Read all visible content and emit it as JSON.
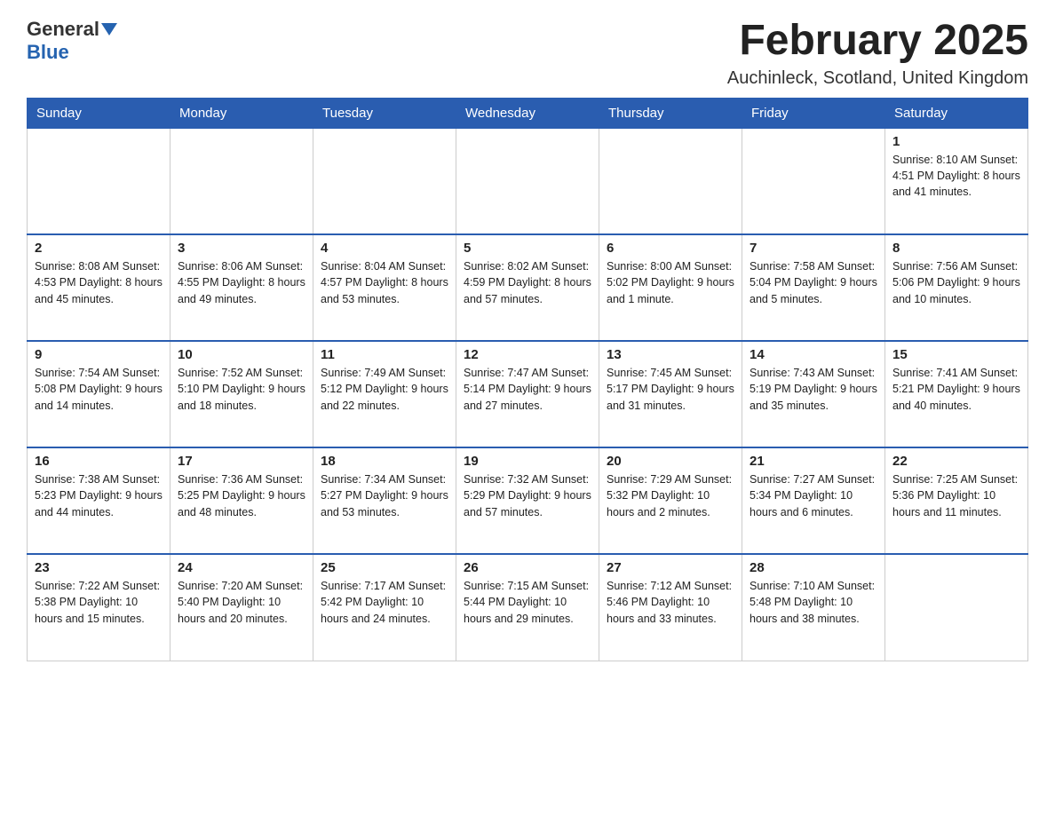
{
  "header": {
    "logo_general": "General",
    "logo_blue": "Blue",
    "month_title": "February 2025",
    "location": "Auchinleck, Scotland, United Kingdom"
  },
  "days_of_week": [
    "Sunday",
    "Monday",
    "Tuesday",
    "Wednesday",
    "Thursday",
    "Friday",
    "Saturday"
  ],
  "weeks": [
    [
      {
        "day": "",
        "info": ""
      },
      {
        "day": "",
        "info": ""
      },
      {
        "day": "",
        "info": ""
      },
      {
        "day": "",
        "info": ""
      },
      {
        "day": "",
        "info": ""
      },
      {
        "day": "",
        "info": ""
      },
      {
        "day": "1",
        "info": "Sunrise: 8:10 AM\nSunset: 4:51 PM\nDaylight: 8 hours\nand 41 minutes."
      }
    ],
    [
      {
        "day": "2",
        "info": "Sunrise: 8:08 AM\nSunset: 4:53 PM\nDaylight: 8 hours\nand 45 minutes."
      },
      {
        "day": "3",
        "info": "Sunrise: 8:06 AM\nSunset: 4:55 PM\nDaylight: 8 hours\nand 49 minutes."
      },
      {
        "day": "4",
        "info": "Sunrise: 8:04 AM\nSunset: 4:57 PM\nDaylight: 8 hours\nand 53 minutes."
      },
      {
        "day": "5",
        "info": "Sunrise: 8:02 AM\nSunset: 4:59 PM\nDaylight: 8 hours\nand 57 minutes."
      },
      {
        "day": "6",
        "info": "Sunrise: 8:00 AM\nSunset: 5:02 PM\nDaylight: 9 hours\nand 1 minute."
      },
      {
        "day": "7",
        "info": "Sunrise: 7:58 AM\nSunset: 5:04 PM\nDaylight: 9 hours\nand 5 minutes."
      },
      {
        "day": "8",
        "info": "Sunrise: 7:56 AM\nSunset: 5:06 PM\nDaylight: 9 hours\nand 10 minutes."
      }
    ],
    [
      {
        "day": "9",
        "info": "Sunrise: 7:54 AM\nSunset: 5:08 PM\nDaylight: 9 hours\nand 14 minutes."
      },
      {
        "day": "10",
        "info": "Sunrise: 7:52 AM\nSunset: 5:10 PM\nDaylight: 9 hours\nand 18 minutes."
      },
      {
        "day": "11",
        "info": "Sunrise: 7:49 AM\nSunset: 5:12 PM\nDaylight: 9 hours\nand 22 minutes."
      },
      {
        "day": "12",
        "info": "Sunrise: 7:47 AM\nSunset: 5:14 PM\nDaylight: 9 hours\nand 27 minutes."
      },
      {
        "day": "13",
        "info": "Sunrise: 7:45 AM\nSunset: 5:17 PM\nDaylight: 9 hours\nand 31 minutes."
      },
      {
        "day": "14",
        "info": "Sunrise: 7:43 AM\nSunset: 5:19 PM\nDaylight: 9 hours\nand 35 minutes."
      },
      {
        "day": "15",
        "info": "Sunrise: 7:41 AM\nSunset: 5:21 PM\nDaylight: 9 hours\nand 40 minutes."
      }
    ],
    [
      {
        "day": "16",
        "info": "Sunrise: 7:38 AM\nSunset: 5:23 PM\nDaylight: 9 hours\nand 44 minutes."
      },
      {
        "day": "17",
        "info": "Sunrise: 7:36 AM\nSunset: 5:25 PM\nDaylight: 9 hours\nand 48 minutes."
      },
      {
        "day": "18",
        "info": "Sunrise: 7:34 AM\nSunset: 5:27 PM\nDaylight: 9 hours\nand 53 minutes."
      },
      {
        "day": "19",
        "info": "Sunrise: 7:32 AM\nSunset: 5:29 PM\nDaylight: 9 hours\nand 57 minutes."
      },
      {
        "day": "20",
        "info": "Sunrise: 7:29 AM\nSunset: 5:32 PM\nDaylight: 10 hours\nand 2 minutes."
      },
      {
        "day": "21",
        "info": "Sunrise: 7:27 AM\nSunset: 5:34 PM\nDaylight: 10 hours\nand 6 minutes."
      },
      {
        "day": "22",
        "info": "Sunrise: 7:25 AM\nSunset: 5:36 PM\nDaylight: 10 hours\nand 11 minutes."
      }
    ],
    [
      {
        "day": "23",
        "info": "Sunrise: 7:22 AM\nSunset: 5:38 PM\nDaylight: 10 hours\nand 15 minutes."
      },
      {
        "day": "24",
        "info": "Sunrise: 7:20 AM\nSunset: 5:40 PM\nDaylight: 10 hours\nand 20 minutes."
      },
      {
        "day": "25",
        "info": "Sunrise: 7:17 AM\nSunset: 5:42 PM\nDaylight: 10 hours\nand 24 minutes."
      },
      {
        "day": "26",
        "info": "Sunrise: 7:15 AM\nSunset: 5:44 PM\nDaylight: 10 hours\nand 29 minutes."
      },
      {
        "day": "27",
        "info": "Sunrise: 7:12 AM\nSunset: 5:46 PM\nDaylight: 10 hours\nand 33 minutes."
      },
      {
        "day": "28",
        "info": "Sunrise: 7:10 AM\nSunset: 5:48 PM\nDaylight: 10 hours\nand 38 minutes."
      },
      {
        "day": "",
        "info": ""
      }
    ]
  ]
}
